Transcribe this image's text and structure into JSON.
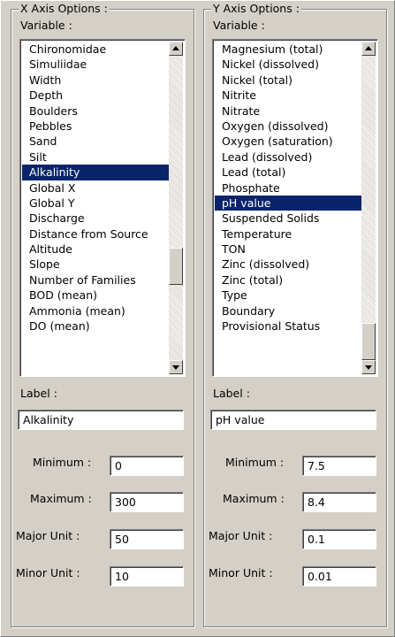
{
  "x_axis": {
    "group_title": "X Axis Options :",
    "variable_label": "Variable :",
    "items": [
      "Chironomidae",
      "Simuliidae",
      "Width",
      "Depth",
      "Boulders",
      "Pebbles",
      "Sand",
      "Silt",
      "Alkalinity",
      "Global X",
      "Global Y",
      "Discharge",
      "Distance from Source",
      "Altitude",
      "Slope",
      "Number of Families",
      "BOD (mean)",
      "Ammonia (mean)",
      "DO (mean)"
    ],
    "selected": "Alkalinity",
    "label_caption": "Label :",
    "label_value": "Alkalinity",
    "minimum_label": "Minimum :",
    "minimum": "0",
    "maximum_label": "Maximum :",
    "maximum": "300",
    "major_label": "Major Unit :",
    "major": "50",
    "minor_label": "Minor Unit :",
    "minor": "10"
  },
  "y_axis": {
    "group_title": "Y Axis Options :",
    "variable_label": "Variable :",
    "items": [
      "Magnesium (total)",
      "Nickel (dissolved)",
      "Nickel (total)",
      "Nitrite",
      "Nitrate",
      "Oxygen (dissolved)",
      "Oxygen (saturation)",
      "Lead (dissolved)",
      "Lead (total)",
      "Phosphate",
      "pH value",
      "Suspended Solids",
      "Temperature",
      "TON",
      "Zinc (dissolved)",
      "Zinc (total)",
      "Type",
      "Boundary",
      "Provisional Status"
    ],
    "selected": "pH value",
    "label_caption": "Label :",
    "label_value": "pH value",
    "minimum_label": "Minimum :",
    "minimum": "7.5",
    "maximum_label": "Maximum :",
    "maximum": "8.4",
    "major_label": "Major Unit :",
    "major": "0.1",
    "minor_label": "Minor Unit :",
    "minor": "0.01"
  },
  "scroll": {
    "x_thumb_fraction": 0.72,
    "y_thumb_fraction": 1.0
  },
  "icons": {
    "scroll_up": "triangle-up-icon",
    "scroll_down": "triangle-down-icon"
  },
  "colors": {
    "selection": "#0a246a",
    "face": "#d4d0c8"
  }
}
